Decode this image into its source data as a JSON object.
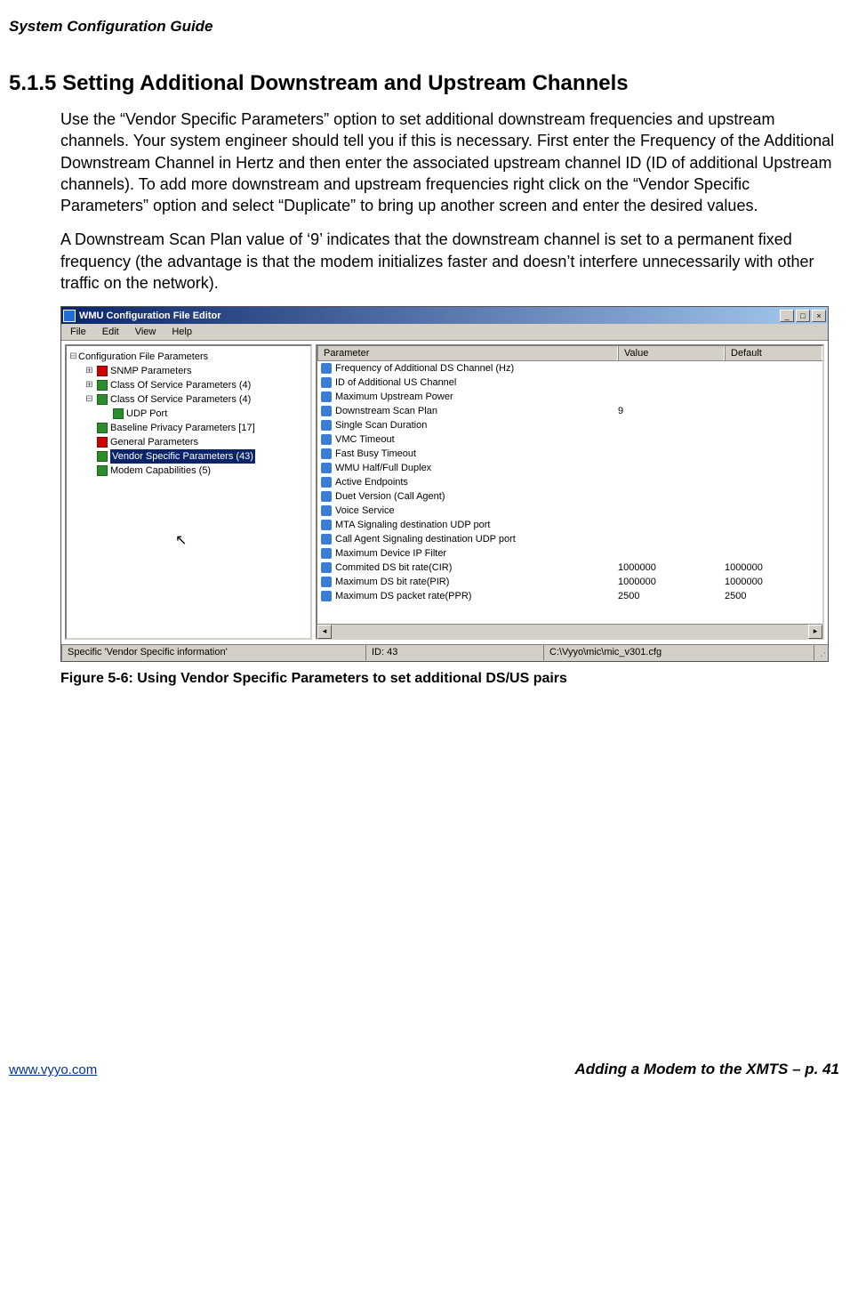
{
  "doc_header": "System Configuration Guide",
  "section_number": "5.1.5",
  "section_title": "Setting Additional Downstream and Upstream Channels",
  "para1": "Use the “Vendor Specific Parameters” option to set additional downstream frequencies and upstream channels.  Your system engineer should tell you if this is necessary.  First enter the Frequency of the Additional Downstream Channel in Hertz and then enter the associated upstream channel ID (ID of additional Upstream channels).  To add more downstream and upstream frequencies right click on the “Vendor Specific Parameters” option and select “Duplicate” to bring up another screen and enter the desired values.",
  "para2": "A Downstream Scan Plan value of ‘9’ indicates that the downstream channel is set to a permanent fixed frequency (the advantage is that the modem initializes faster and doesn’t interfere unnecessarily with other traffic on the network).",
  "window": {
    "title": "WMU Configuration File Editor",
    "menu": {
      "file": "File",
      "edit": "Edit",
      "view": "View",
      "help": "Help"
    },
    "tree": {
      "root": "Configuration File Parameters",
      "n1": "SNMP Parameters",
      "n2": "Class Of Service Parameters (4)",
      "n3": "Class Of Service Parameters (4)",
      "n3a": "UDP Port",
      "n4": "Baseline Privacy Parameters [17]",
      "n5": "General Parameters",
      "n6": "Vendor Specific Parameters (43)",
      "n7": "Modem Capabilities (5)"
    },
    "columns": {
      "param": "Parameter",
      "value": "Value",
      "default": "Default"
    },
    "rows": [
      {
        "param": "Frequency of Additional DS Channel (Hz)",
        "value": "",
        "default": ""
      },
      {
        "param": "ID of Additional US Channel",
        "value": "",
        "default": ""
      },
      {
        "param": "Maximum Upstream Power",
        "value": "",
        "default": ""
      },
      {
        "param": "Downstream Scan Plan",
        "value": "9",
        "default": ""
      },
      {
        "param": "Single Scan Duration",
        "value": "",
        "default": ""
      },
      {
        "param": "VMC Timeout",
        "value": "",
        "default": ""
      },
      {
        "param": "Fast Busy Timeout",
        "value": "",
        "default": ""
      },
      {
        "param": "WMU  Half/Full Duplex",
        "value": "",
        "default": ""
      },
      {
        "param": "Active Endpoints",
        "value": "",
        "default": ""
      },
      {
        "param": "Duet Version (Call Agent)",
        "value": "",
        "default": ""
      },
      {
        "param": "Voice Service",
        "value": "",
        "default": ""
      },
      {
        "param": "MTA Signaling destination UDP port",
        "value": "",
        "default": ""
      },
      {
        "param": "Call Agent Signaling destination UDP port",
        "value": "",
        "default": ""
      },
      {
        "param": "Maximum Device IP Filter",
        "value": "",
        "default": ""
      },
      {
        "param": "Commited DS bit rate(CIR)",
        "value": "1000000",
        "default": "1000000"
      },
      {
        "param": "Maximum DS bit rate(PIR)",
        "value": "1000000",
        "default": "1000000"
      },
      {
        "param": "Maximum DS packet rate(PPR)",
        "value": "2500",
        "default": "2500"
      }
    ],
    "status": {
      "s1": "Specific 'Vendor Specific information'",
      "s2": "ID: 43",
      "s3": "C:\\Vyyo\\mic\\mic_v301.cfg"
    }
  },
  "figure_caption": "Figure 5-6: Using Vendor Specific Parameters to set additional DS/US pairs",
  "footer": {
    "left": "www.vyyo.com",
    "right": "Adding a Modem to the XMTS – p. 41"
  }
}
